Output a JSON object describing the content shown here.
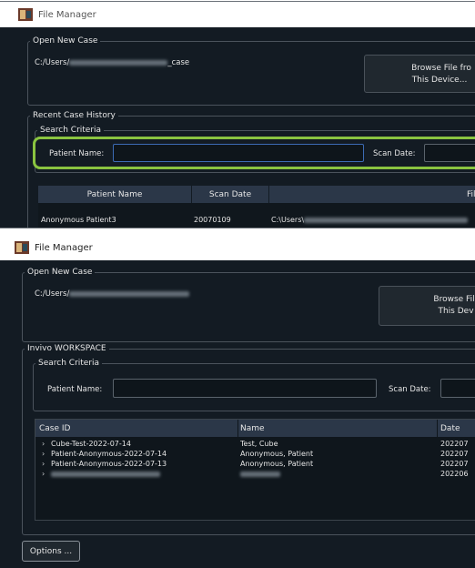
{
  "window1": {
    "title": "File Manager",
    "open_new_case": {
      "legend": "Open New Case",
      "path_prefix": "C:/Users/",
      "path_suffix": "_case",
      "browse_line1": "Browse File fro",
      "browse_line2": "This Device..."
    },
    "recent": {
      "legend": "Recent Case History",
      "search_legend": "Search Criteria",
      "patient_name_label": "Patient Name:",
      "scan_date_label": "Scan Date:",
      "columns": [
        "Patient Name",
        "Scan Date",
        "File"
      ],
      "row": {
        "patient_name": "Anonymous Patient3",
        "scan_date": "20070109",
        "file_prefix": "C:\\Users\\"
      }
    }
  },
  "window2": {
    "title": "File Manager",
    "open_new_case": {
      "legend": "Open New Case",
      "path_prefix": "C:/Users/",
      "browse_line1": "Browse Fil",
      "browse_line2": "This Dev"
    },
    "workspace": {
      "legend": "Invivo WORKSPACE",
      "search_legend": "Search Criteria",
      "patient_name_label": "Patient Name:",
      "scan_date_label": "Scan Date:",
      "columns": [
        "Case ID",
        "Name",
        "Date"
      ],
      "rows": [
        {
          "case_id": "Cube-Test-2022-07-14",
          "name": "Test, Cube",
          "date": "202207"
        },
        {
          "case_id": "Patient-Anonymous-2022-07-14",
          "name": "Anonymous, Patient",
          "date": "202207"
        },
        {
          "case_id": "Patient-Anonymous-2022-07-13",
          "name": "Anonymous, Patient",
          "date": "202207"
        },
        {
          "case_id": "",
          "name": "",
          "date": "202206"
        }
      ]
    },
    "options_label": "Options ..."
  }
}
